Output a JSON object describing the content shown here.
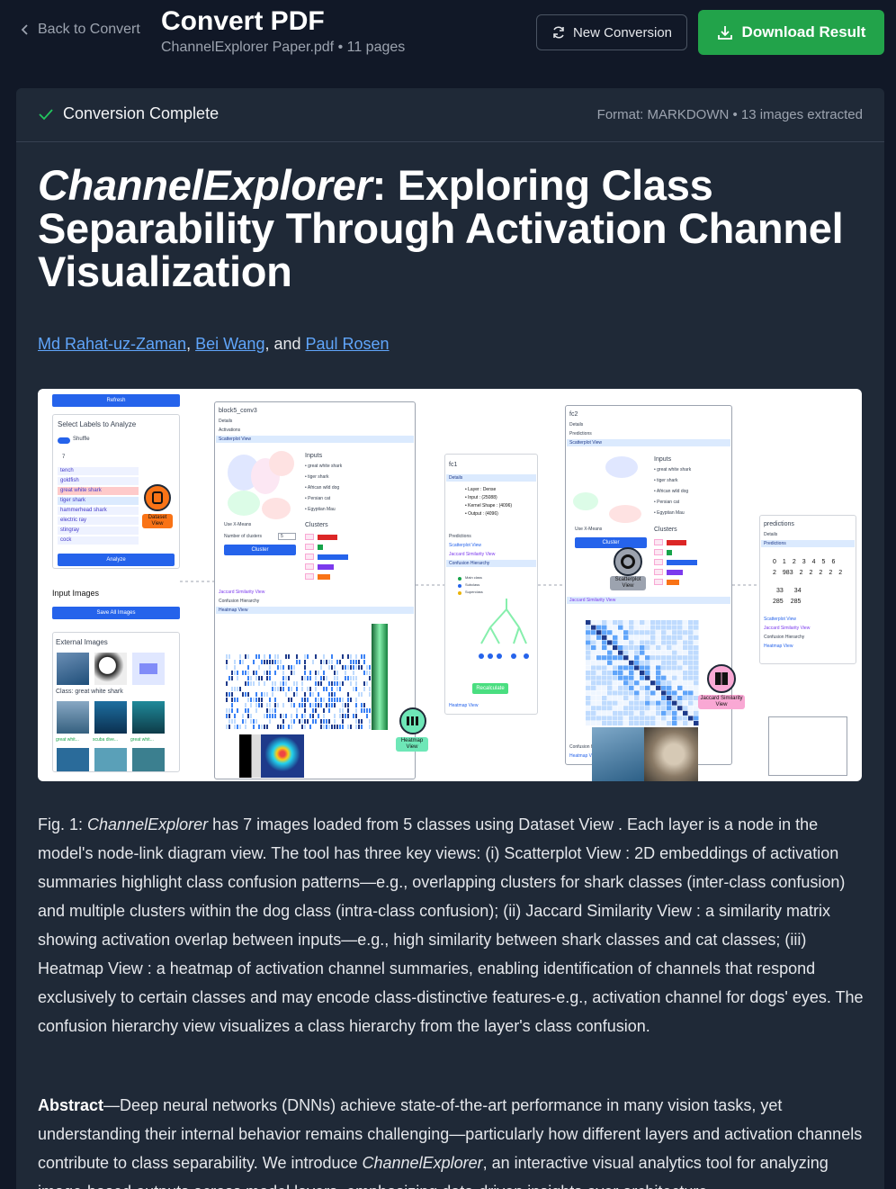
{
  "header": {
    "back_label": "Back to Convert",
    "title": "Convert PDF",
    "file_name": "ChannelExplorer Paper.pdf",
    "pages": "11 pages",
    "new_conversion_label": "New Conversion",
    "download_label": "Download Result"
  },
  "status": {
    "label": "Conversion Complete",
    "format_info": "Format: MARKDOWN",
    "images_info": "13 images extracted"
  },
  "document": {
    "title_italic": "ChannelExplorer",
    "title_rest": ": Exploring Class Separability Through Activation Channel Visualization",
    "authors": [
      "Md Rahat-uz-Zaman",
      "Bei Wang",
      "Paul Rosen"
    ],
    "author_sep": ", ",
    "author_and": ", and ",
    "caption_prefix": "Fig. 1: ",
    "caption_italic": "ChannelExplorer",
    "caption_rest": " has 7 images loaded from 5 classes using Dataset View . Each layer is a node in the model's node-link diagram view. The tool has three key views: (i) Scatterplot View : 2D embeddings of activation summaries highlight class confusion patterns—e.g., overlapping clusters for shark classes (inter-class confusion) and multiple clusters within the dog class (intra-class confusion); (ii) Jaccard Similarity View : a similarity matrix showing activation overlap between inputs—e.g., high similarity between shark classes and cat classes; (iii) Heatmap View : a heatmap of activation channel summaries, enabling identification of channels that respond exclusively to certain classes and may encode class-distinctive features-e.g., activation channel for dogs' eyes. The confusion hierarchy view visualizes a class hierarchy from the layer's class confusion.",
    "abstract_label": "Abstract",
    "abstract_text_1": "—Deep neural networks (DNNs) achieve state-of-the-art performance in many vision tasks, yet understanding their internal behavior remains challenging—particularly how different layers and activation channels contribute to class separability. We introduce ",
    "abstract_italic": "ChannelExplorer",
    "abstract_text_2": ", an interactive visual analytics tool for analyzing image-based outputs across model layers, emphasizing data-driven insights over architecture"
  },
  "figure": {
    "refresh": "Refresh",
    "select_labels": "Select Labels to Analyze",
    "shuffle": "Shuffle",
    "count": "7",
    "labels": [
      "tench",
      "goldfish",
      "great white shark",
      "tiger shark",
      "hammerhead shark",
      "electric ray",
      "stingray",
      "cock"
    ],
    "analyze": "Analyze",
    "input_images": "Input Images",
    "save_all": "Save All Images",
    "external_images": "External Images",
    "class_label": "Class: great white shark",
    "thumb_captions": [
      "great whit...",
      "scuba dive...",
      "great whit..."
    ],
    "dataset_view": "Dataset View",
    "block_name": "block5_conv3",
    "details": "Details",
    "activations": "Activations",
    "scatterplot_view": "Scatterplot View",
    "inputs": "Inputs",
    "input_classes": [
      "great white shark",
      "tiger shark",
      "African wild dog",
      "Persian cat",
      "Egyptian Mau"
    ],
    "use_kmeans": "Use X-Means",
    "num_clusters": "Number of clusters",
    "num_clusters_val": "5",
    "cluster_btn": "Cluster",
    "clusters": "Clusters",
    "jaccard_view": "Jaccard Similarity View",
    "confusion_hierarchy": "Confusion Hierarchy",
    "heatmap_view": "Heatmap View",
    "fc1": "fc1",
    "fc1_details": [
      "Layer : Dense",
      "Input : (25088)",
      "Kernel Shape : (4096)",
      "Output : (4096)"
    ],
    "predictions": "Predictions",
    "recalculate": "Recalculate",
    "fc2": "fc2",
    "predictions_node": "predictions",
    "pred_nums_row1": [
      "0",
      "1",
      "2",
      "3",
      "4",
      "5",
      "6"
    ],
    "pred_nums_row2": [
      "2",
      "983",
      "2",
      "2",
      "2",
      "2",
      "2"
    ],
    "pred_nums_row3": [
      "33",
      "34"
    ],
    "pred_nums_row4": [
      "285",
      "285"
    ],
    "scatterplot_badge": "Scatterplot View",
    "jaccard_badge": "Jaccard Similarity View",
    "heatmap_badge": "Heatmap View",
    "tree_legend": [
      "Main class",
      "Subclass",
      "Superclass"
    ]
  },
  "colors": {
    "background": "#111827",
    "panel": "#1f2937",
    "accent_green": "#22a34a",
    "link_blue": "#60a5fa",
    "check_green": "#22c55e"
  }
}
